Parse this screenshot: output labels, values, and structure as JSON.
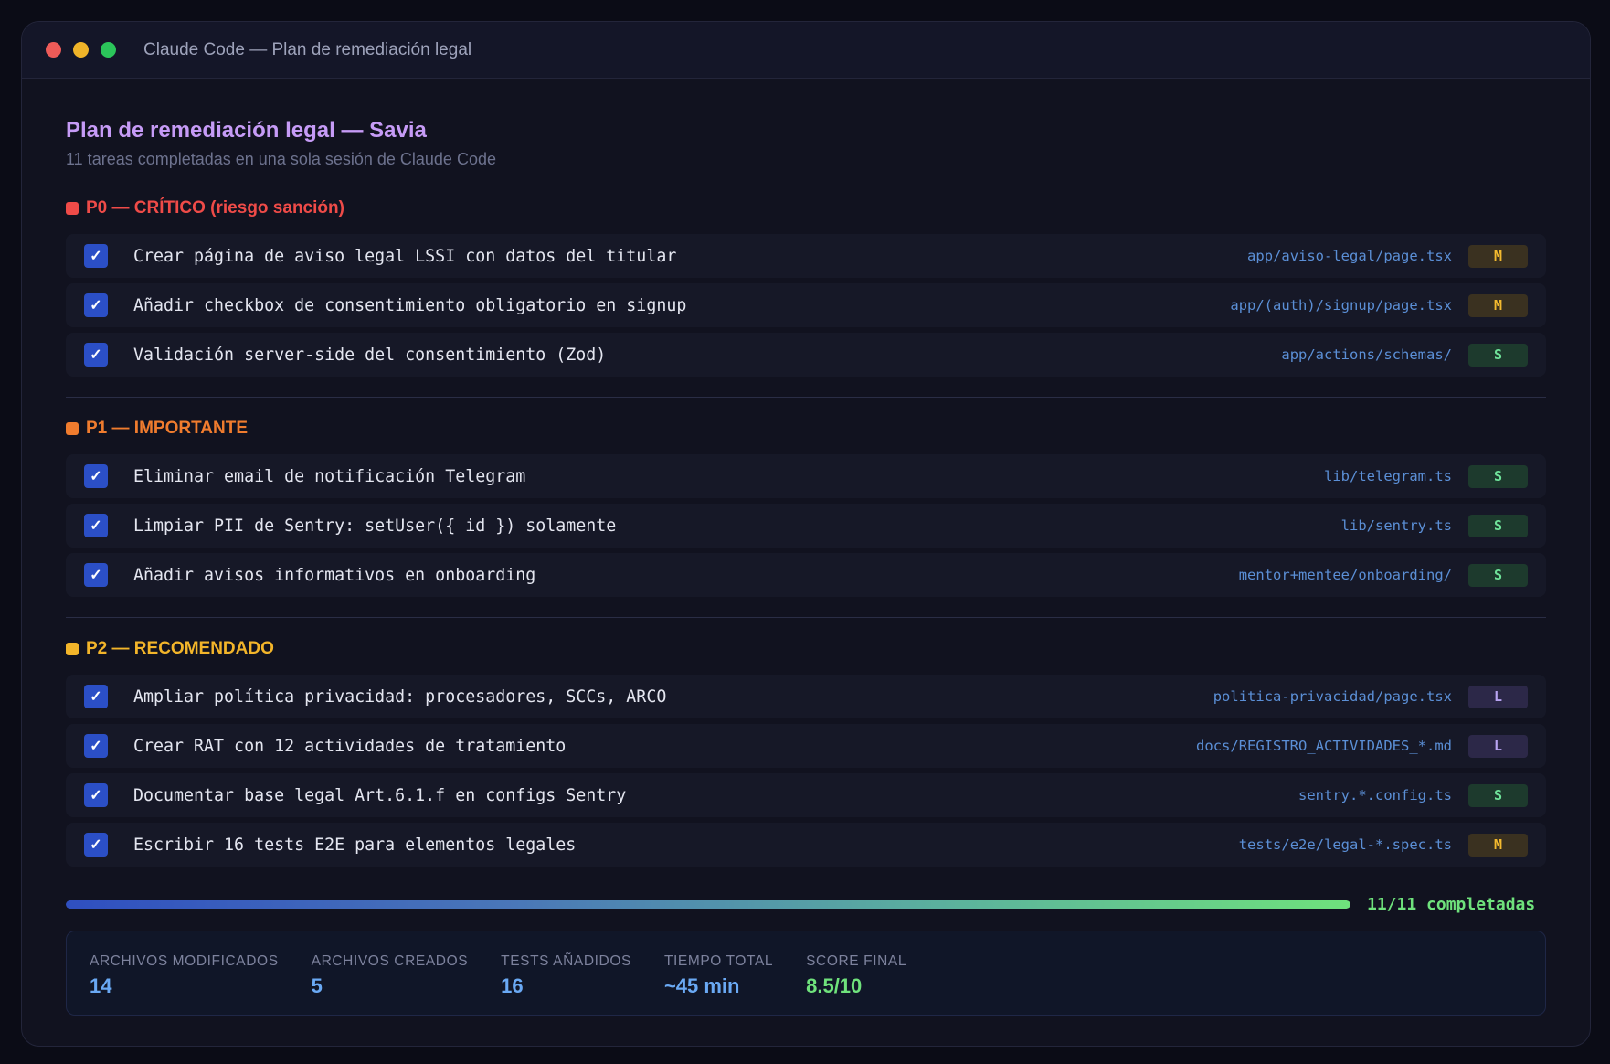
{
  "window": {
    "title": "Claude Code — Plan de remediación legal"
  },
  "header": {
    "title": "Plan de remediación legal — Savia",
    "subtitle": "11 tareas completadas en una sola sesión de Claude Code"
  },
  "sections": [
    {
      "label": "P0 — CRÍTICO (riesgo sanción)",
      "color": "#ef4b48",
      "tasks": [
        {
          "text": "Crear página de aviso legal LSSI con datos del titular",
          "file": "app/aviso-legal/page.tsx",
          "size": "M",
          "done": true
        },
        {
          "text": "Añadir checkbox de consentimiento obligatorio en signup",
          "file": "app/(auth)/signup/page.tsx",
          "size": "M",
          "done": true
        },
        {
          "text": "Validación server-side del consentimiento (Zod)",
          "file": "app/actions/schemas/",
          "size": "S",
          "done": true
        }
      ]
    },
    {
      "label": "P1 — IMPORTANTE",
      "color": "#f07c2e",
      "tasks": [
        {
          "text": "Eliminar email de notificación Telegram",
          "file": "lib/telegram.ts",
          "size": "S",
          "done": true
        },
        {
          "text": "Limpiar PII de Sentry: setUser({ id }) solamente",
          "file": "lib/sentry.ts",
          "size": "S",
          "done": true
        },
        {
          "text": "Añadir avisos informativos en onboarding",
          "file": "mentor+mentee/onboarding/",
          "size": "S",
          "done": true
        }
      ]
    },
    {
      "label": "P2 — RECOMENDADO",
      "color": "#f3b52a",
      "tasks": [
        {
          "text": "Ampliar política privacidad: procesadores, SCCs, ARCO",
          "file": "politica-privacidad/page.tsx",
          "size": "L",
          "done": true
        },
        {
          "text": "Crear RAT con 12 actividades de tratamiento",
          "file": "docs/REGISTRO_ACTIVIDADES_*.md",
          "size": "L",
          "done": true
        },
        {
          "text": "Documentar base legal Art.6.1.f en configs Sentry",
          "file": "sentry.*.config.ts",
          "size": "S",
          "done": true
        },
        {
          "text": "Escribir 16 tests E2E para elementos legales",
          "file": "tests/e2e/legal-*.spec.ts",
          "size": "M",
          "done": true
        }
      ]
    }
  ],
  "check_glyph": "✓",
  "progress": {
    "fraction": 1.0,
    "label": "11/11 completadas"
  },
  "stats": [
    {
      "label": "ARCHIVOS MODIFICADOS",
      "value": "14",
      "color": "#6aa9f4"
    },
    {
      "label": "ARCHIVOS CREADOS",
      "value": "5",
      "color": "#6aa9f4"
    },
    {
      "label": "TESTS AÑADIDOS",
      "value": "16",
      "color": "#6aa9f4"
    },
    {
      "label": "TIEMPO TOTAL",
      "value": "~45 min",
      "color": "#6aa9f4"
    },
    {
      "label": "SCORE FINAL",
      "value": "8.5/10",
      "color": "#6fe27c"
    }
  ]
}
